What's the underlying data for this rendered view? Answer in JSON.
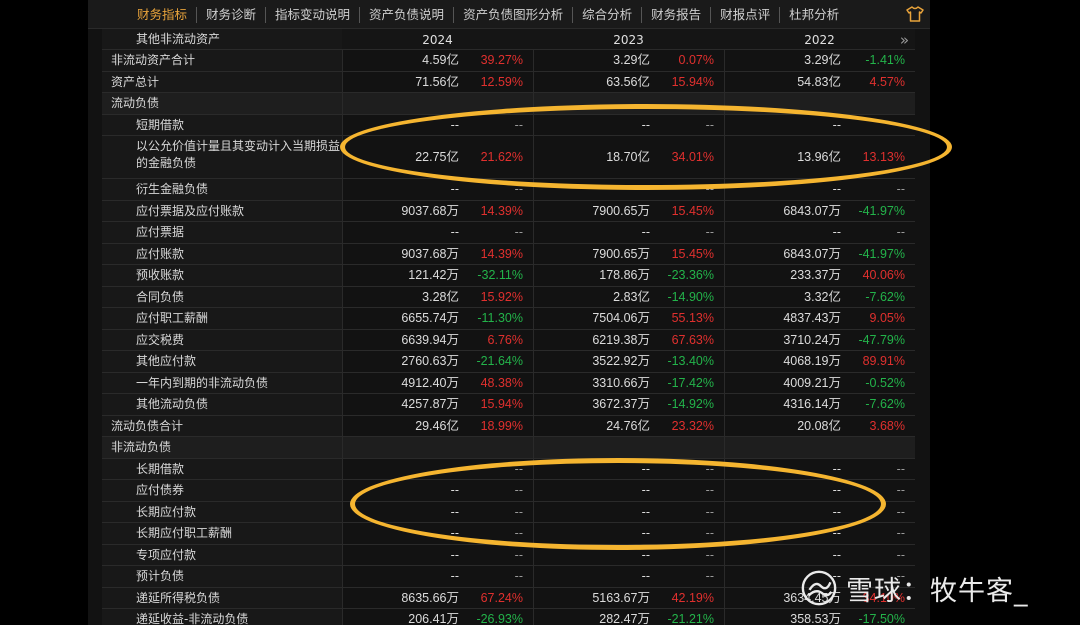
{
  "nav": {
    "tabs": [
      {
        "label": "财务指标",
        "active": true
      },
      {
        "label": "财务诊断"
      },
      {
        "label": "指标变动说明"
      },
      {
        "label": "资产负债说明"
      },
      {
        "label": "资产负债图形分析"
      },
      {
        "label": "综合分析"
      },
      {
        "label": "财务报告"
      },
      {
        "label": "财报点评"
      },
      {
        "label": "杜邦分析"
      }
    ],
    "right_icon": "tshirt-icon"
  },
  "table": {
    "header_label": "其他非流动资产",
    "years": [
      "2024",
      "2023",
      "2022"
    ],
    "next_icon": "double-chevron-right-icon",
    "rows": [
      {
        "label": "非流动资产合计",
        "indent": false,
        "vals": [
          [
            "4.59亿",
            "39.27%",
            "up"
          ],
          [
            "3.29亿",
            "0.07%",
            "up"
          ],
          [
            "3.29亿",
            "-1.41%",
            "dn"
          ]
        ]
      },
      {
        "label": "资产总计",
        "indent": false,
        "vals": [
          [
            "71.56亿",
            "12.59%",
            "up"
          ],
          [
            "63.56亿",
            "15.94%",
            "up"
          ],
          [
            "54.83亿",
            "4.57%",
            "up"
          ]
        ]
      },
      {
        "label": "流动负债",
        "indent": false,
        "section": true
      },
      {
        "label": "短期借款",
        "indent": true,
        "vals": [
          [
            "--",
            "--",
            "dash"
          ],
          [
            "--",
            "--",
            "dash"
          ],
          [
            "--",
            "--",
            "dash"
          ]
        ]
      },
      {
        "label": "以公允价值计量且其变动计入当期损益的金融负债",
        "indent": true,
        "tall": true,
        "vals": [
          [
            "22.75亿",
            "21.62%",
            "up"
          ],
          [
            "18.70亿",
            "34.01%",
            "up"
          ],
          [
            "13.96亿",
            "13.13%",
            "up"
          ]
        ]
      },
      {
        "label": "衍生金融负债",
        "indent": true,
        "vals": [
          [
            "--",
            "--",
            "dash"
          ],
          [
            "--",
            "--",
            "dash"
          ],
          [
            "--",
            "--",
            "dash"
          ]
        ]
      },
      {
        "label": "应付票据及应付账款",
        "indent": true,
        "vals": [
          [
            "9037.68万",
            "14.39%",
            "up"
          ],
          [
            "7900.65万",
            "15.45%",
            "up"
          ],
          [
            "6843.07万",
            "-41.97%",
            "dn"
          ]
        ]
      },
      {
        "label": "应付票据",
        "indent": true,
        "vals": [
          [
            "--",
            "--",
            "dash"
          ],
          [
            "--",
            "--",
            "dash"
          ],
          [
            "--",
            "--",
            "dash"
          ]
        ]
      },
      {
        "label": "应付账款",
        "indent": true,
        "vals": [
          [
            "9037.68万",
            "14.39%",
            "up"
          ],
          [
            "7900.65万",
            "15.45%",
            "up"
          ],
          [
            "6843.07万",
            "-41.97%",
            "dn"
          ]
        ]
      },
      {
        "label": "预收账款",
        "indent": true,
        "vals": [
          [
            "121.42万",
            "-32.11%",
            "dn"
          ],
          [
            "178.86万",
            "-23.36%",
            "dn"
          ],
          [
            "233.37万",
            "40.06%",
            "up"
          ]
        ]
      },
      {
        "label": "合同负债",
        "indent": true,
        "vals": [
          [
            "3.28亿",
            "15.92%",
            "up"
          ],
          [
            "2.83亿",
            "-14.90%",
            "dn"
          ],
          [
            "3.32亿",
            "-7.62%",
            "dn"
          ]
        ]
      },
      {
        "label": "应付职工薪酬",
        "indent": true,
        "vals": [
          [
            "6655.74万",
            "-11.30%",
            "dn"
          ],
          [
            "7504.06万",
            "55.13%",
            "up"
          ],
          [
            "4837.43万",
            "9.05%",
            "up"
          ]
        ]
      },
      {
        "label": "应交税费",
        "indent": true,
        "vals": [
          [
            "6639.94万",
            "6.76%",
            "up"
          ],
          [
            "6219.38万",
            "67.63%",
            "up"
          ],
          [
            "3710.24万",
            "-47.79%",
            "dn"
          ]
        ]
      },
      {
        "label": "其他应付款",
        "indent": true,
        "vals": [
          [
            "2760.63万",
            "-21.64%",
            "dn"
          ],
          [
            "3522.92万",
            "-13.40%",
            "dn"
          ],
          [
            "4068.19万",
            "89.91%",
            "up"
          ]
        ]
      },
      {
        "label": "一年内到期的非流动负债",
        "indent": true,
        "vals": [
          [
            "4912.40万",
            "48.38%",
            "up"
          ],
          [
            "3310.66万",
            "-17.42%",
            "dn"
          ],
          [
            "4009.21万",
            "-0.52%",
            "dn"
          ]
        ]
      },
      {
        "label": "其他流动负债",
        "indent": true,
        "vals": [
          [
            "4257.87万",
            "15.94%",
            "up"
          ],
          [
            "3672.37万",
            "-14.92%",
            "dn"
          ],
          [
            "4316.14万",
            "-7.62%",
            "dn"
          ]
        ]
      },
      {
        "label": "流动负债合计",
        "indent": false,
        "vals": [
          [
            "29.46亿",
            "18.99%",
            "up"
          ],
          [
            "24.76亿",
            "23.32%",
            "up"
          ],
          [
            "20.08亿",
            "3.68%",
            "up"
          ]
        ]
      },
      {
        "label": "非流动负债",
        "indent": false,
        "section": true
      },
      {
        "label": "长期借款",
        "indent": true,
        "vals": [
          [
            "--",
            "--",
            "dash"
          ],
          [
            "--",
            "--",
            "dash"
          ],
          [
            "--",
            "--",
            "dash"
          ]
        ]
      },
      {
        "label": "应付债券",
        "indent": true,
        "vals": [
          [
            "--",
            "--",
            "dash"
          ],
          [
            "--",
            "--",
            "dash"
          ],
          [
            "--",
            "--",
            "dash"
          ]
        ]
      },
      {
        "label": "长期应付款",
        "indent": true,
        "vals": [
          [
            "--",
            "--",
            "dash"
          ],
          [
            "--",
            "--",
            "dash"
          ],
          [
            "--",
            "--",
            "dash"
          ]
        ]
      },
      {
        "label": "长期应付职工薪酬",
        "indent": true,
        "vals": [
          [
            "--",
            "--",
            "dash"
          ],
          [
            "--",
            "--",
            "dash"
          ],
          [
            "--",
            "--",
            "dash"
          ]
        ]
      },
      {
        "label": "专项应付款",
        "indent": true,
        "vals": [
          [
            "--",
            "--",
            "dash"
          ],
          [
            "--",
            "--",
            "dash"
          ],
          [
            "--",
            "--",
            "dash"
          ]
        ]
      },
      {
        "label": "预计负债",
        "indent": true,
        "vals": [
          [
            "--",
            "--",
            "dash"
          ],
          [
            "--",
            "--",
            "dash"
          ],
          [
            "--",
            "--",
            "dash"
          ]
        ]
      },
      {
        "label": "递延所得税负债",
        "indent": true,
        "vals": [
          [
            "8635.66万",
            "67.24%",
            "up"
          ],
          [
            "5163.67万",
            "42.19%",
            "up"
          ],
          [
            "3634.45万",
            "34.10%",
            "up"
          ]
        ]
      },
      {
        "label": "递延收益-非流动负债",
        "indent": true,
        "vals": [
          [
            "206.41万",
            "-26.93%",
            "dn"
          ],
          [
            "282.47万",
            "-21.21%",
            "dn"
          ],
          [
            "358.53万",
            "-17.50%",
            "dn"
          ]
        ]
      }
    ]
  },
  "watermark": {
    "text": "雪球：牧牛客_",
    "logo": "snowball-logo-icon"
  },
  "colors": {
    "accent": "#e8a33b",
    "up": "#e0302e",
    "down": "#23b34a",
    "annotation": "#f5b530"
  }
}
